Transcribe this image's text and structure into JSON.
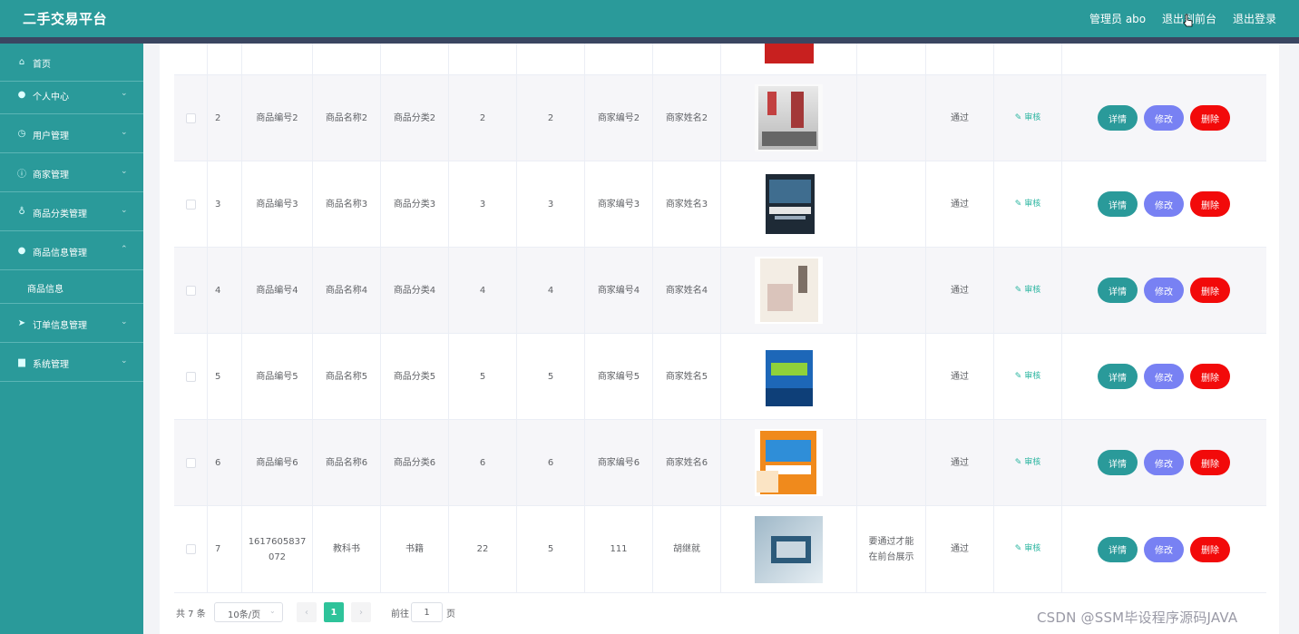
{
  "app": {
    "title": "二手交易平台"
  },
  "header": {
    "admin_label": "管理员 abo",
    "front_label": "退出到前台",
    "logout_label": "退出登录"
  },
  "sidebar": {
    "items": [
      {
        "label": "首页",
        "icon": "home-icon"
      },
      {
        "label": "个人中心",
        "icon": "user-icon"
      },
      {
        "label": "用户管理",
        "icon": "clock-icon"
      },
      {
        "label": "商家管理",
        "icon": "info-icon"
      },
      {
        "label": "商品分类管理",
        "icon": "mic-icon"
      },
      {
        "label": "商品信息管理",
        "icon": "user-icon"
      },
      {
        "label": "订单信息管理",
        "icon": "send-icon"
      },
      {
        "label": "系统管理",
        "icon": "trash-icon"
      }
    ],
    "sub_item": "商品信息"
  },
  "table": {
    "rows": [
      {
        "idx": "2",
        "code": "商品编号2",
        "name": "商品名称2",
        "cat": "商品分类2",
        "a": "2",
        "b": "2",
        "mcode": "商家编号2",
        "mname": "商家姓名2",
        "reply": "",
        "status": "通过",
        "audit": "审核",
        "cover": "book-gray"
      },
      {
        "idx": "3",
        "code": "商品编号3",
        "name": "商品名称3",
        "cat": "商品分类3",
        "a": "3",
        "b": "3",
        "mcode": "商家编号3",
        "mname": "商家姓名3",
        "reply": "",
        "status": "通过",
        "audit": "审核",
        "cover": "book-dark"
      },
      {
        "idx": "4",
        "code": "商品编号4",
        "name": "商品名称4",
        "cat": "商品分类4",
        "a": "4",
        "b": "4",
        "mcode": "商家编号4",
        "mname": "商家姓名4",
        "reply": "",
        "status": "通过",
        "audit": "审核",
        "cover": "book-light"
      },
      {
        "idx": "5",
        "code": "商品编号5",
        "name": "商品名称5",
        "cat": "商品分类5",
        "a": "5",
        "b": "5",
        "mcode": "商家编号5",
        "mname": "商家姓名5",
        "reply": "",
        "status": "通过",
        "audit": "审核",
        "cover": "book-blue"
      },
      {
        "idx": "6",
        "code": "商品编号6",
        "name": "商品名称6",
        "cat": "商品分类6",
        "a": "6",
        "b": "6",
        "mcode": "商家编号6",
        "mname": "商家姓名6",
        "reply": "",
        "status": "通过",
        "audit": "审核",
        "cover": "book-orange"
      },
      {
        "idx": "7",
        "code": "1617605837072",
        "name": "教科书",
        "cat": "书籍",
        "a": "22",
        "b": "5",
        "mcode": "111",
        "mname": "胡继就",
        "reply": "要通过才能在前台展示",
        "status": "通过",
        "audit": "审核",
        "cover": "book-photo"
      }
    ],
    "btn_detail": "详情",
    "btn_edit": "修改",
    "btn_delete": "删除"
  },
  "pagination": {
    "total": "共 7 条",
    "page_size": "10条/页",
    "current": "1",
    "goto": "前往",
    "goto_value": "1",
    "page_unit": "页"
  },
  "watermark": "CSDN @SSM毕设程序源码JAVA",
  "colors": {
    "primary": "#2a9a9a",
    "edit": "#7881f3",
    "delete": "#f20a0a",
    "pager_active": "#2ec39a"
  }
}
